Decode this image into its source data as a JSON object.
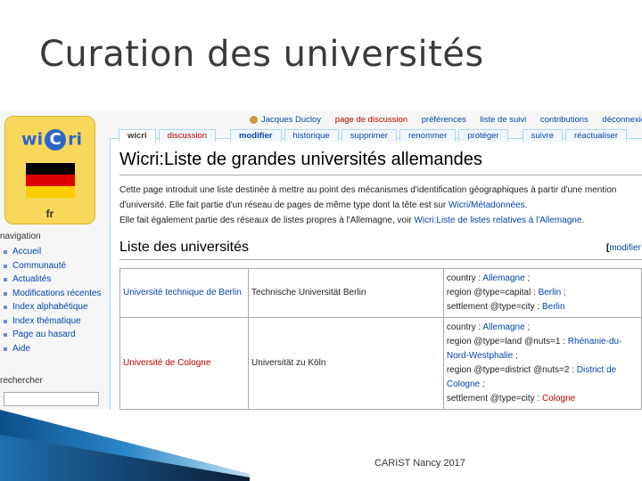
{
  "slide": {
    "title": "Curation des universités",
    "footer": "CARIST Nancy 2017"
  },
  "logo": {
    "part1": "wi",
    "letter": "C",
    "part2": "ri",
    "lang": "fr",
    "flag_colors": [
      "#000000",
      "#dd0000",
      "#ffce00"
    ]
  },
  "sidebar": {
    "nav_heading": "navigation",
    "items": [
      {
        "label": "Accueil"
      },
      {
        "label": "Communauté"
      },
      {
        "label": "Actualités"
      },
      {
        "label": "Modifications récentes"
      },
      {
        "label": "Index alphabétique"
      },
      {
        "label": "Index thématique"
      },
      {
        "label": "Page au hasard"
      },
      {
        "label": "Aide"
      }
    ],
    "search_heading": "rechercher"
  },
  "personal": {
    "user": "Jacques Ducloy",
    "talk": "page de discussion",
    "prefs": "préférences",
    "watchlist": "liste de suivi",
    "contribs": "contributions",
    "logout": "déconnexion"
  },
  "tabs": {
    "page": "wicri",
    "discussion": "discussion",
    "edit": "modifier",
    "history": "historique",
    "delete": "supprimer",
    "move": "renommer",
    "protect": "protéger",
    "watch": "suivre",
    "refresh": "réactualiser"
  },
  "page": {
    "title": "Wicri:Liste de grandes universités allemandes",
    "intro1_a": "Cette page introduit une liste destinée à mettre au point des mécanismes d'identification géographiques à partir d'une mention",
    "intro1_b": "d'université. Elle fait partie d'un réseau de pages de même type dont la tête est sur ",
    "intro1_link": "Wicri/Métadonnées",
    "intro1_end": ".",
    "intro2_a": "Elle fait également partie des réseaux de listes propres à l'Allemagne, voir ",
    "intro2_link": "Wicri:Liste de listes relatives à l'Allemagne",
    "intro2_end": ".",
    "section_title": "Liste des universités",
    "section_edit_open": "[",
    "section_edit": "modifier"
  },
  "table": {
    "rows": [
      {
        "name": "Université technique de Berlin",
        "native": "Technische Universität Berlin",
        "l1_label": "country : ",
        "l1_value": "Allemagne",
        "l1_end": " ;",
        "l2_label": "region @type=capital : ",
        "l2_value": "Berlin",
        "l2_end": " ;",
        "l3_label": "settlement @type=city : ",
        "l3_value": "Berlin"
      },
      {
        "name": "Université de Cologne",
        "native": "Universität zu Köln",
        "l1_label": "country : ",
        "l1_value": "Allemagne",
        "l1_end": " ;",
        "l2_label": "region @type=land @nuts=1 : ",
        "l2_value": "Rhénanie-du-Nord-Westphalie",
        "l2_end": " ;",
        "l3_label": "region @type=district @nuts=2 : ",
        "l3_value": "District de Cologne",
        "l3_end": " ;",
        "l4_label": "settlement @type=city : ",
        "l4_value": "Cologne"
      }
    ]
  }
}
